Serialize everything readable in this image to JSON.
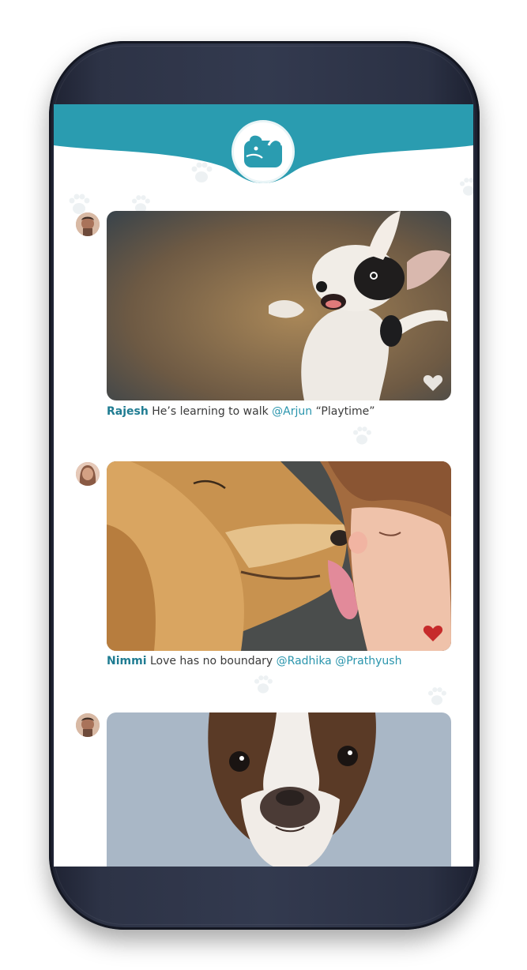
{
  "app": {
    "header_color": "#2a9cb0",
    "accent_color": "#1f7c92",
    "logo_icon": "dog-logo-icon"
  },
  "posts": [
    {
      "user": "Rajesh",
      "text": "He’s learning to walk",
      "mentions": [
        "@Arjun"
      ],
      "tag": "“Playtime”",
      "liked": false
    },
    {
      "user": "Nimmi",
      "text": "Love has no boundary",
      "mentions": [
        "@Radhika",
        "@Prathyush"
      ],
      "tag": "",
      "liked": true
    },
    {
      "user": "",
      "text": "",
      "mentions": [],
      "tag": "",
      "liked": false
    }
  ]
}
